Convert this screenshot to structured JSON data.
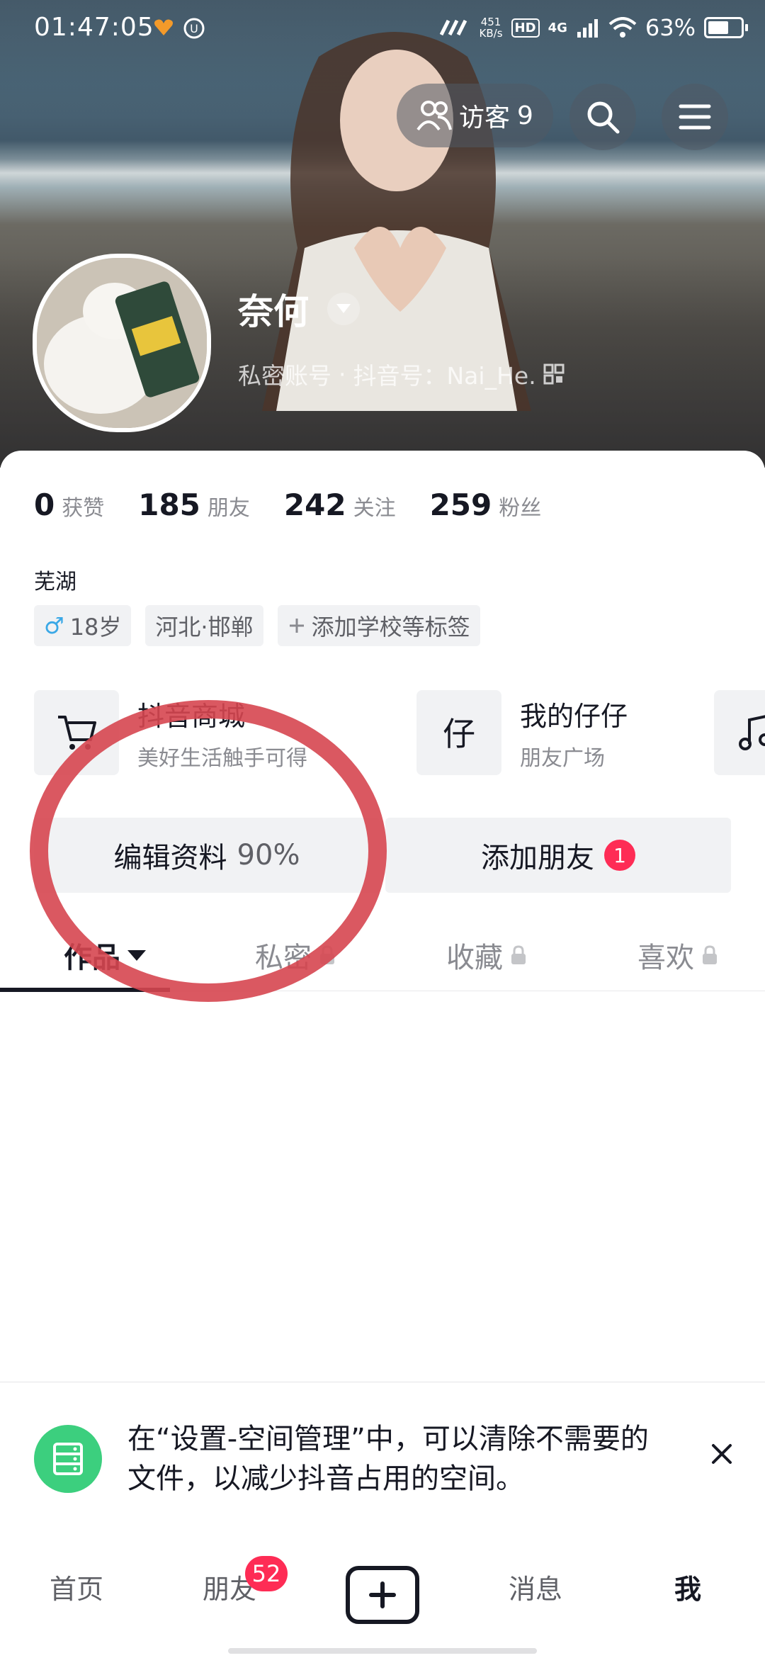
{
  "status_bar": {
    "time": "01:47:05",
    "net_speed_value": "451",
    "net_speed_unit": "KB/s",
    "hd": "HD",
    "network": "4G",
    "battery": "63%"
  },
  "header": {
    "visitors_label": "访客",
    "visitors_count": "9"
  },
  "profile": {
    "name": "奈何",
    "account_type": "私密账号",
    "douyin_id": "抖音号：Nai_He."
  },
  "stats": [
    {
      "num": "0",
      "label": "获赞"
    },
    {
      "num": "185",
      "label": "朋友"
    },
    {
      "num": "242",
      "label": "关注"
    },
    {
      "num": "259",
      "label": "粉丝"
    }
  ],
  "bio": "芜湖",
  "tags": {
    "gender_age": "18岁",
    "location": "河北·邯郸",
    "add": "添加学校等标签"
  },
  "cards": [
    {
      "title": "抖音商城",
      "subtitle": "美好生活触手可得",
      "icon": "cart-icon"
    },
    {
      "title": "我的仔仔",
      "subtitle": "朋友广场",
      "icon": "zaizai-icon"
    }
  ],
  "buttons": {
    "edit_label": "编辑资料",
    "edit_pct": "90%",
    "add_friend_label": "添加朋友",
    "add_friend_badge": "1"
  },
  "tabs": [
    {
      "label": "作品",
      "locked": false
    },
    {
      "label": "私密",
      "locked": true
    },
    {
      "label": "收藏",
      "locked": true
    },
    {
      "label": "喜欢",
      "locked": true
    }
  ],
  "tip": {
    "text": "在“设置-空间管理”中，可以清除不需要的文件，以减少抖音占用的空间。"
  },
  "bottom_nav": {
    "home": "首页",
    "friends": "朋友",
    "friends_badge": "52",
    "messages": "消息",
    "me": "我"
  },
  "colors": {
    "accent_red": "#fe2c55",
    "tip_green": "#3ccf7e",
    "annotation_red": "#d64650"
  }
}
